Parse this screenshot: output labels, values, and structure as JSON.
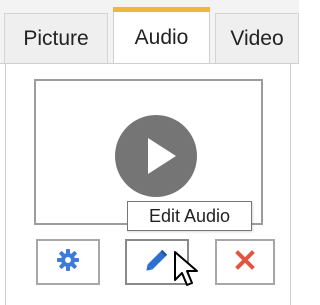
{
  "tabs": [
    {
      "label": "Picture",
      "selected": false
    },
    {
      "label": "Audio",
      "selected": true
    },
    {
      "label": "Video",
      "selected": false
    }
  ],
  "accent_color": "#f2b73a",
  "media_preview": {
    "icon": "play-icon"
  },
  "tooltip": {
    "text": "Edit Audio"
  },
  "toolbar": {
    "buttons": [
      {
        "icon": "gear-icon",
        "color": "#3d7bd9"
      },
      {
        "icon": "pencil-icon",
        "color": "#2e6fd3"
      },
      {
        "icon": "close-icon",
        "color": "#e2553e"
      }
    ]
  },
  "cursor": {
    "icon": "mouse-pointer-icon"
  }
}
